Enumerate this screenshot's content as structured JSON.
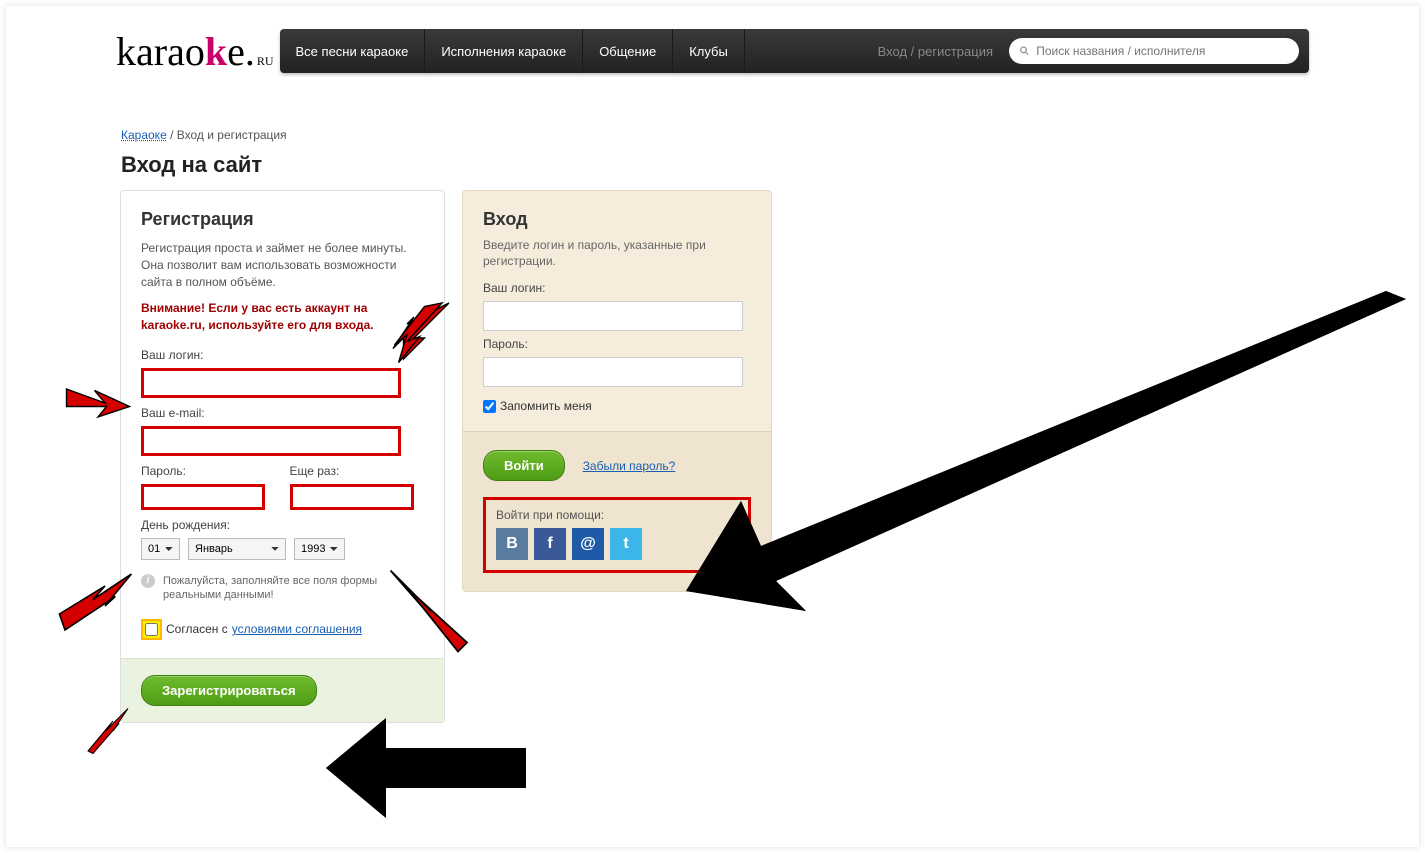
{
  "logo": {
    "text": "karao",
    "k": "k",
    "e": "e",
    "ru": "RU"
  },
  "nav": {
    "items": [
      "Все песни караоке",
      "Исполнения караоке",
      "Общение",
      "Клубы"
    ],
    "auth": "Вход / регистрация"
  },
  "search": {
    "placeholder": "Поиск названия / исполнителя"
  },
  "breadcrumb": {
    "root": "Караоке",
    "sep": " / ",
    "current": "Вход и регистрация"
  },
  "page_title": "Вход на сайт",
  "registration": {
    "title": "Регистрация",
    "desc": "Регистрация проста и займет не более минуты. Она позволит вам использовать возможности сайта в полном объёме.",
    "warning": "Внимание! Если у вас есть аккаунт на karaoke.ru, используйте его для входа.",
    "login_label": "Ваш логин:",
    "email_label": "Ваш e-mail:",
    "password_label": "Пароль:",
    "password2_label": "Еще раз:",
    "birthday_label": "День рождения:",
    "day": "01",
    "month": "Январь",
    "year": "1993",
    "form_hint": "Пожалуйста, заполняйте все поля формы реальными данными!",
    "agree_text": "Согласен с ",
    "agree_link": "условиями соглашения",
    "submit": "Зарегистрироваться"
  },
  "login": {
    "title": "Вход",
    "desc": "Введите логин и пароль, указанные при регистрации.",
    "login_label": "Ваш логин:",
    "password_label": "Пароль:",
    "remember": "Запомнить меня",
    "submit": "Войти",
    "forgot": "Забыли пароль?",
    "social_label": "Войти при помощи:",
    "social": {
      "vk": "B",
      "fb": "f",
      "mr": "@",
      "tw": "t"
    }
  }
}
